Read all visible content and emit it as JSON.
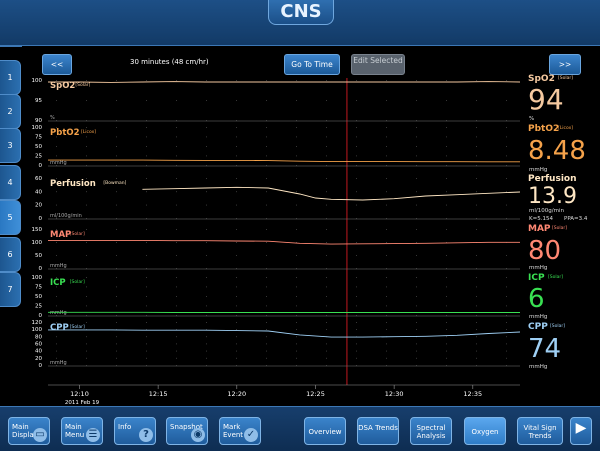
{
  "app": {
    "title": "CNS"
  },
  "sidebar": {
    "tabs": [
      "1",
      "2",
      "3",
      "4",
      "5",
      "6",
      "7"
    ],
    "active_index": 4
  },
  "toolbar": {
    "prev": "<<",
    "duration": "30 minutes  (48 cm/hr)",
    "go_to_time": "Go To Time",
    "edit_selected": "Edit Selected",
    "next": ">>"
  },
  "time_axis": {
    "ticks": [
      "12:10",
      "12:15",
      "12:20",
      "12:25",
      "12:30",
      "12:35"
    ],
    "date": "2011 Feb 19"
  },
  "colors": {
    "spo2": "#f5c9a0",
    "pbto2": "#f5a24a",
    "perfusion": "#ffe7c4",
    "map": "#ff8873",
    "icp": "#39e052",
    "cpp": "#9fd0f5",
    "cursor": "#c0181f"
  },
  "chart_data": [
    {
      "type": "line",
      "name": "SpO2",
      "tag": "[Solar]",
      "unit": "%",
      "ylim": [
        0,
        100
      ],
      "yticks": [
        "100",
        "95",
        "90"
      ],
      "x": [
        0,
        2,
        4,
        6,
        8,
        10,
        12,
        14,
        16,
        18,
        20,
        22,
        24,
        26,
        28,
        30
      ],
      "values": [
        95,
        95,
        94,
        95,
        96,
        95,
        95,
        95,
        95,
        95,
        95,
        95,
        95,
        95,
        96,
        95
      ]
    },
    {
      "type": "line",
      "name": "PbtO2",
      "tag": "[Licox]",
      "unit": "mmHg",
      "ylim": [
        0,
        100
      ],
      "yticks": [
        "100",
        "75",
        "50",
        "25",
        "0"
      ],
      "x": [
        0,
        2,
        4,
        6,
        8,
        10,
        12,
        14,
        16,
        18,
        20,
        22,
        24,
        26,
        28,
        30
      ],
      "values": [
        13,
        13,
        13,
        13,
        12.5,
        12,
        12,
        11.5,
        10,
        9,
        9,
        9,
        8.8,
        8.6,
        8.5,
        8.5
      ]
    },
    {
      "type": "line",
      "name": "Perfusion",
      "tag": "[Bowman]",
      "unit": "ml/100g/min",
      "ylim": [
        0,
        60
      ],
      "yticks": [
        "60",
        "40",
        "20",
        "0"
      ],
      "x": [
        6,
        8,
        10,
        12,
        14,
        16,
        17,
        18,
        20,
        22,
        24,
        26,
        28,
        30
      ],
      "values": [
        43,
        44,
        45,
        46,
        45,
        36,
        30,
        28,
        27,
        29,
        33,
        35,
        37,
        39
      ]
    },
    {
      "type": "line",
      "name": "MAP",
      "tag": "[Solar]",
      "unit": "mmHg",
      "ylim": [
        0,
        150
      ],
      "yticks": [
        "150",
        "100",
        "50",
        "0"
      ],
      "x": [
        0,
        2,
        4,
        6,
        8,
        10,
        12,
        14,
        16,
        18,
        20,
        22,
        24,
        26,
        28,
        30
      ],
      "values": [
        106,
        106,
        106,
        106,
        105,
        105,
        104,
        103,
        95,
        92,
        93,
        94,
        95,
        97,
        99,
        99
      ]
    },
    {
      "type": "line",
      "name": "ICP",
      "tag": "[Solar]",
      "unit": "mmHg",
      "ylim": [
        0,
        100
      ],
      "yticks": [
        "100",
        "75",
        "50",
        "25",
        "0"
      ],
      "x": [
        0,
        2,
        4,
        6,
        8,
        10,
        12,
        14,
        16,
        18,
        20,
        22,
        24,
        26,
        28,
        30
      ],
      "values": [
        7,
        7,
        7,
        7,
        6.5,
        6.5,
        6.5,
        6.5,
        6.5,
        6.5,
        6.5,
        6.5,
        6.5,
        6.5,
        6.5,
        6.5
      ]
    },
    {
      "type": "line",
      "name": "CPP",
      "tag": "[Solar]",
      "unit": "mmHg",
      "ylim": [
        0,
        120
      ],
      "yticks": [
        "120",
        "100",
        "80",
        "60",
        "40",
        "20",
        "0"
      ],
      "x": [
        0,
        2,
        4,
        6,
        8,
        10,
        12,
        14,
        16,
        18,
        20,
        22,
        24,
        26,
        28,
        30
      ],
      "values": [
        98,
        98,
        98,
        97,
        97,
        97,
        96,
        95,
        84,
        78,
        78,
        79,
        80,
        83,
        88,
        92
      ]
    }
  ],
  "current": {
    "spo2": {
      "label": "SpO2",
      "tag": "[Solar]",
      "value": "94",
      "unit": "%"
    },
    "pbto2": {
      "label": "PbtO2",
      "tag": "[Licox]",
      "value": "8.48",
      "unit": "mmHg"
    },
    "perfusion": {
      "label": "Perfusion",
      "tag": "[Bowman]",
      "value": "13.9",
      "unit": "ml/100g/min",
      "k": "K=5.154",
      "ppa": "PPA=3.4"
    },
    "map": {
      "label": "MAP",
      "tag": "[Solar]",
      "value": "80",
      "unit": "mmHg"
    },
    "icp": {
      "label": "ICP",
      "tag": "[Solar]",
      "value": "6",
      "unit": "mmHg"
    },
    "cpp": {
      "label": "CPP",
      "tag": "[Solar]",
      "value": "74",
      "unit": "mmHg"
    }
  },
  "bottom": {
    "main_display": "Main Display",
    "main_menu": "Main Menu",
    "info": "Info",
    "snapshot": "Snapshot",
    "mark_event": "Mark Event",
    "overview": "Overview",
    "dsa_trends": "DSA Trends",
    "spectral_analysis": "Spectral Analysis",
    "oxygen": "Oxygen",
    "vital_sign_trends": "Vital Sign Trends"
  }
}
